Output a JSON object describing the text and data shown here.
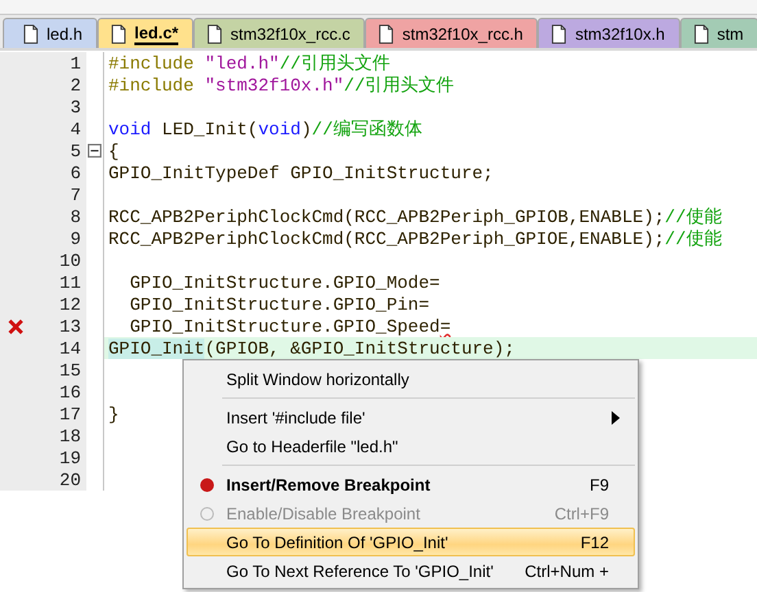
{
  "tabs": [
    {
      "label": "led.h",
      "selected": false,
      "color": "#c6d5f0"
    },
    {
      "label": "led.c*",
      "selected": true,
      "color": "#ffe18c"
    },
    {
      "label": "stm32f10x_rcc.c",
      "selected": false,
      "color": "#c4d3a4"
    },
    {
      "label": "stm32f10x_rcc.h",
      "selected": false,
      "color": "#efa3a3"
    },
    {
      "label": "stm32f10x.h",
      "selected": false,
      "color": "#bca9e0"
    },
    {
      "label": "stm",
      "selected": false,
      "color": "#a3cbb4"
    }
  ],
  "editor": {
    "lines": [
      {
        "number": "1",
        "error": false,
        "current": false,
        "fold": false,
        "tokens": [
          {
            "kind": "directive",
            "text": "#include "
          },
          {
            "kind": "string",
            "text": "\"led.h\""
          },
          {
            "kind": "comment",
            "text": "//引用头文件"
          }
        ]
      },
      {
        "number": "2",
        "error": false,
        "current": false,
        "fold": false,
        "tokens": [
          {
            "kind": "directive",
            "text": "#include "
          },
          {
            "kind": "string",
            "text": "\"stm32f10x.h\""
          },
          {
            "kind": "comment",
            "text": "//引用头文件"
          }
        ]
      },
      {
        "number": "3",
        "error": false,
        "current": false,
        "fold": false
      },
      {
        "number": "4",
        "error": false,
        "current": false,
        "fold": false,
        "tokens": [
          {
            "kind": "keyword",
            "text": "void"
          },
          {
            "kind": "plain",
            "text": " LED_Init("
          },
          {
            "kind": "keyword",
            "text": "void"
          },
          {
            "kind": "plain",
            "text": ")"
          },
          {
            "kind": "comment",
            "text": "//编写函数体"
          }
        ]
      },
      {
        "number": "5",
        "error": false,
        "current": false,
        "fold": true,
        "tokens": [
          {
            "kind": "plain",
            "text": "{"
          }
        ]
      },
      {
        "number": "6",
        "error": false,
        "current": false,
        "fold": false,
        "tokens": [
          {
            "kind": "plain",
            "text": "GPIO_InitTypeDef GPIO_InitStructure;"
          }
        ]
      },
      {
        "number": "7",
        "error": false,
        "current": false,
        "fold": false
      },
      {
        "number": "8",
        "error": false,
        "current": false,
        "fold": false,
        "tokens": [
          {
            "kind": "plain",
            "text": "RCC_APB2PeriphClockCmd(RCC_APB2Periph_GPIOB,ENABLE);"
          },
          {
            "kind": "comment",
            "text": "//使能"
          }
        ]
      },
      {
        "number": "9",
        "error": false,
        "current": false,
        "fold": false,
        "tokens": [
          {
            "kind": "plain",
            "text": "RCC_APB2PeriphClockCmd(RCC_APB2Periph_GPIOE,ENABLE);"
          },
          {
            "kind": "comment",
            "text": "//使能"
          }
        ]
      },
      {
        "number": "10",
        "error": false,
        "current": false,
        "fold": false
      },
      {
        "number": "11",
        "error": false,
        "current": false,
        "fold": false,
        "tokens": [
          {
            "kind": "plain",
            "text": "  GPIO_InitStructure.GPIO_Mode="
          }
        ]
      },
      {
        "number": "12",
        "error": false,
        "current": false,
        "fold": false,
        "tokens": [
          {
            "kind": "plain",
            "text": "  GPIO_InitStructure.GPIO_Pin="
          }
        ]
      },
      {
        "number": "13",
        "error": true,
        "current": false,
        "fold": false,
        "tokens": [
          {
            "kind": "plain",
            "text": "  GPIO_InitStructure.GPIO_Speed"
          },
          {
            "kind": "squiggle",
            "text": "="
          }
        ]
      },
      {
        "number": "14",
        "error": false,
        "current": true,
        "fold": false,
        "tokens": [
          {
            "kind": "match",
            "text": "GPIO_Init"
          },
          {
            "kind": "plain",
            "text": "(GPIOB, &GPIO_InitStructure);"
          }
        ]
      },
      {
        "number": "15",
        "error": false,
        "current": false,
        "fold": false
      },
      {
        "number": "16",
        "error": false,
        "current": false,
        "fold": false
      },
      {
        "number": "17",
        "error": false,
        "current": false,
        "fold": false,
        "tokens": [
          {
            "kind": "plain",
            "text": "}"
          }
        ]
      },
      {
        "number": "18",
        "error": false,
        "current": false,
        "fold": false
      },
      {
        "number": "19",
        "error": false,
        "current": false,
        "fold": false
      },
      {
        "number": "20",
        "error": false,
        "current": false,
        "fold": false
      }
    ]
  },
  "context_menu": {
    "items": [
      {
        "kind": "item",
        "label": "Split Window horizontally",
        "selected": false,
        "disabled": false,
        "bold": false,
        "submenu": false
      },
      {
        "kind": "separator"
      },
      {
        "kind": "item",
        "label": "Insert '#include file'",
        "selected": false,
        "disabled": false,
        "bold": false,
        "submenu": true
      },
      {
        "kind": "item",
        "label": "Go to Headerfile \"led.h\"",
        "selected": false,
        "disabled": false,
        "bold": false,
        "submenu": false
      },
      {
        "kind": "separator"
      },
      {
        "kind": "breakpoint",
        "label": "Insert/Remove Breakpoint",
        "shortcut": "F9",
        "selected": false,
        "disabled": false,
        "bold": true,
        "submenu": false
      },
      {
        "kind": "breakpoint",
        "label": "Enable/Disable Breakpoint",
        "shortcut": "Ctrl+F9",
        "selected": false,
        "disabled": true,
        "bold": false,
        "submenu": false
      },
      {
        "kind": "item",
        "label": "Go To Definition Of 'GPIO_Init'",
        "shortcut": "F12",
        "selected": true,
        "disabled": false,
        "bold": false,
        "submenu": false
      },
      {
        "kind": "item",
        "label": "Go To Next Reference To 'GPIO_Init'",
        "shortcut": "Ctrl+Num +",
        "selected": false,
        "disabled": false,
        "bold": false,
        "submenu": false
      }
    ]
  }
}
